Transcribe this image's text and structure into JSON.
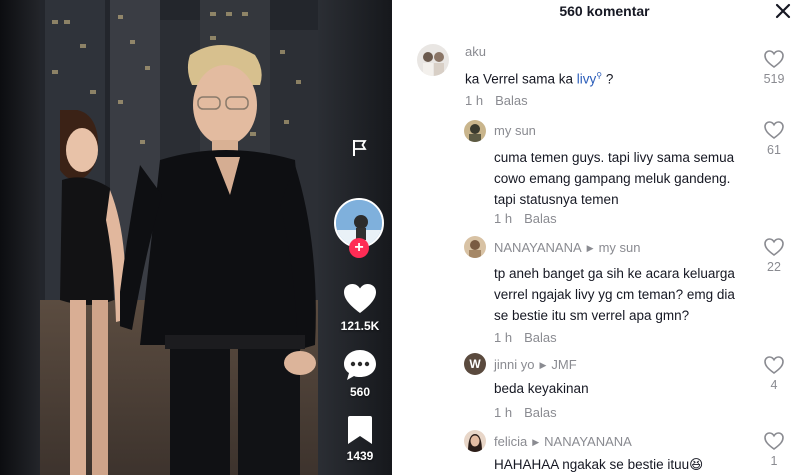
{
  "video": {
    "likes": "121.5K",
    "comments": "560",
    "saves": "1439"
  },
  "panel": {
    "title": "560 komentar"
  },
  "comments": [
    {
      "user": "aku",
      "text_before": "ka Verrel sama ka ",
      "mention": "livy",
      "text_after": " ?",
      "time": "1 h",
      "reply": "Balas",
      "likes": "519"
    },
    {
      "user": "my sun",
      "text": "cuma temen guys. tapi livy sama semua cowo emang gampang meluk gandeng. tapi statusnya temen",
      "time": "1 h",
      "reply": "Balas",
      "likes": "61"
    },
    {
      "user": "NANAYANANA",
      "reply_to": "my sun",
      "text": "tp aneh banget ga sih ke acara keluarga verrel ngajak livy yg cm teman? emg dia se bestie itu sm verrel apa gmn?",
      "time": "1 h",
      "reply": "Balas",
      "likes": "22"
    },
    {
      "user": "jinni yo",
      "reply_to": "JMF",
      "avatar_letter": "W",
      "text": "beda keyakinan",
      "time": "1 h",
      "reply": "Balas",
      "likes": "4"
    },
    {
      "user": "felicia",
      "reply_to": "NANAYANANA",
      "text": "HAHAHAA ngakak se bestie ituu😆",
      "likes": "1"
    }
  ],
  "colors": {
    "accent_red": "#fe2c55",
    "mention_blue": "#2b5db9",
    "muted_gray": "#8a8b91",
    "text_dark": "#161823"
  }
}
